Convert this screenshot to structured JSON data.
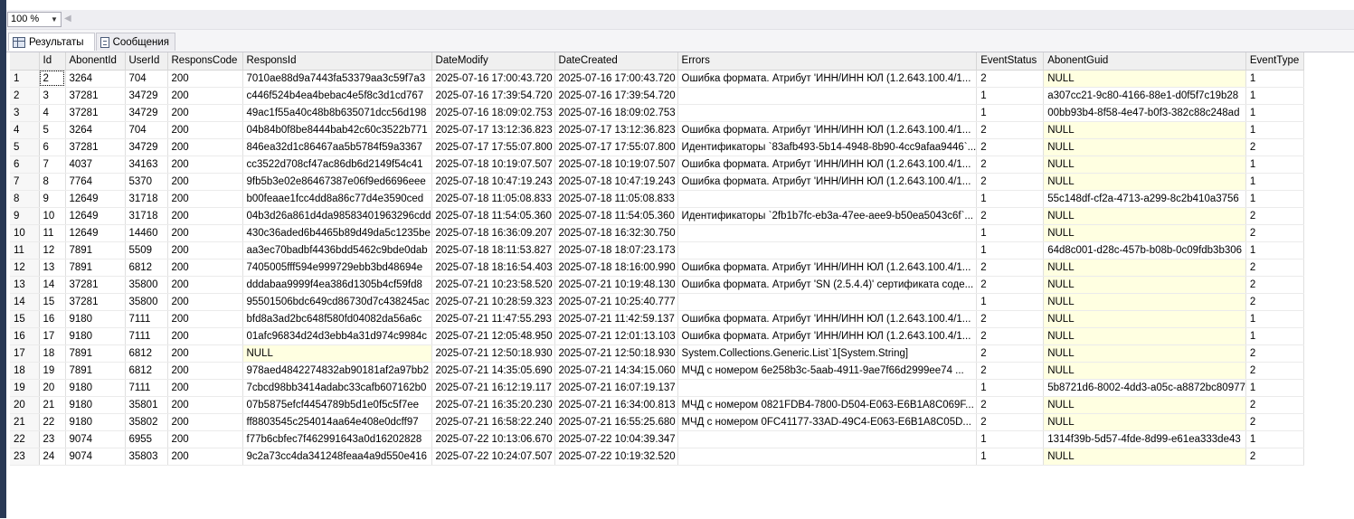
{
  "zoom": {
    "value": "100 %"
  },
  "tabs": [
    {
      "label": "Результаты",
      "icon": "grid-results-icon",
      "active": true
    },
    {
      "label": "Сообщения",
      "icon": "messages-icon",
      "active": false
    }
  ],
  "colors": {
    "left_bar": "#293955",
    "null_cell": "#ffffe1"
  },
  "grid": {
    "columns": [
      "",
      "Id",
      "AbonentId",
      "UserId",
      "ResponsCode",
      "ResponsId",
      "DateModify",
      "DateCreated",
      "Errors",
      "EventStatus",
      "AbonentGuid",
      "EventType"
    ],
    "rows": [
      [
        "1",
        "2",
        "3264",
        "704",
        "200",
        "7010ae88d9a7443fa53379aa3c59f7a3",
        "2025-07-16 17:00:43.720",
        "2025-07-16 17:00:43.720",
        "Ошибка формата. Атрибут 'ИНН/ИНН ЮЛ (1.2.643.100.4/1...",
        "2",
        "NULL",
        "1"
      ],
      [
        "2",
        "3",
        "37281",
        "34729",
        "200",
        "c446f524b4ea4bebac4e5f8c3d1cd767",
        "2025-07-16 17:39:54.720",
        "2025-07-16 17:39:54.720",
        "",
        "1",
        "a307cc21-9c80-4166-88e1-d0f5f7c19b28",
        "1"
      ],
      [
        "3",
        "4",
        "37281",
        "34729",
        "200",
        "49ac1f55a40c48b8b635071dcc56d198",
        "2025-07-16 18:09:02.753",
        "2025-07-16 18:09:02.753",
        "",
        "1",
        "00bb93b4-8f58-4e47-b0f3-382c88c248ad",
        "1"
      ],
      [
        "4",
        "5",
        "3264",
        "704",
        "200",
        "04b84b0f8be8444bab42c60c3522b771",
        "2025-07-17 13:12:36.823",
        "2025-07-17 13:12:36.823",
        "Ошибка формата. Атрибут 'ИНН/ИНН ЮЛ (1.2.643.100.4/1...",
        "2",
        "NULL",
        "1"
      ],
      [
        "5",
        "6",
        "37281",
        "34729",
        "200",
        "846ea32d1c86467aa5b5784f59a3367",
        "2025-07-17 17:55:07.800",
        "2025-07-17 17:55:07.800",
        "Идентификаторы `83afb493-5b14-4948-8b90-4cc9afaa9446`...",
        "2",
        "NULL",
        "2"
      ],
      [
        "6",
        "7",
        "4037",
        "34163",
        "200",
        "cc3522d708cf47ac86db6d2149f54c41",
        "2025-07-18 10:19:07.507",
        "2025-07-18 10:19:07.507",
        "Ошибка формата. Атрибут 'ИНН/ИНН ЮЛ (1.2.643.100.4/1...",
        "2",
        "NULL",
        "1"
      ],
      [
        "7",
        "8",
        "7764",
        "5370",
        "200",
        "9fb5b3e02e86467387e06f9ed6696eee",
        "2025-07-18 10:47:19.243",
        "2025-07-18 10:47:19.243",
        "Ошибка формата. Атрибут 'ИНН/ИНН ЮЛ (1.2.643.100.4/1...",
        "2",
        "NULL",
        "1"
      ],
      [
        "8",
        "9",
        "12649",
        "31718",
        "200",
        "b00feaae1fcc4dd8a86c77d4e3590ced",
        "2025-07-18 11:05:08.833",
        "2025-07-18 11:05:08.833",
        "",
        "1",
        "55c148df-cf2a-4713-a299-8c2b410a3756",
        "1"
      ],
      [
        "9",
        "10",
        "12649",
        "31718",
        "200",
        "04b3d26a861d4da98583401963296cdd",
        "2025-07-18 11:54:05.360",
        "2025-07-18 11:54:05.360",
        "Идентификаторы `2fb1b7fc-eb3a-47ee-aee9-b50ea5043c6f`...",
        "2",
        "NULL",
        "2"
      ],
      [
        "10",
        "11",
        "12649",
        "14460",
        "200",
        "430c36aded6b4465b89d49da5c1235be",
        "2025-07-18 16:36:09.207",
        "2025-07-18 16:32:30.750",
        "",
        "1",
        "NULL",
        "2"
      ],
      [
        "11",
        "12",
        "7891",
        "5509",
        "200",
        "aa3ec70badbf4436bdd5462c9bde0dab",
        "2025-07-18 18:11:53.827",
        "2025-07-18 18:07:23.173",
        "",
        "1",
        "64d8c001-d28c-457b-b08b-0c09fdb3b306",
        "1"
      ],
      [
        "12",
        "13",
        "7891",
        "6812",
        "200",
        "7405005fff594e999729ebb3bd48694e",
        "2025-07-18 18:16:54.403",
        "2025-07-18 18:16:00.990",
        "Ошибка формата. Атрибут 'ИНН/ИНН ЮЛ (1.2.643.100.4/1...",
        "2",
        "NULL",
        "2"
      ],
      [
        "13",
        "14",
        "37281",
        "35800",
        "200",
        "dddabaa9999f4ea386d1305b4cf59fd8",
        "2025-07-21 10:23:58.520",
        "2025-07-21 10:19:48.130",
        "Ошибка формата. Атрибут 'SN (2.5.4.4)' сертификата соде...",
        "2",
        "NULL",
        "2"
      ],
      [
        "14",
        "15",
        "37281",
        "35800",
        "200",
        "95501506bdc649cd86730d7c438245ac",
        "2025-07-21 10:28:59.323",
        "2025-07-21 10:25:40.777",
        "",
        "1",
        "NULL",
        "2"
      ],
      [
        "15",
        "16",
        "9180",
        "7111",
        "200",
        "bfd8a3ad2bc648f580fd04082da56a6c",
        "2025-07-21 11:47:55.293",
        "2025-07-21 11:42:59.137",
        "Ошибка формата. Атрибут 'ИНН/ИНН ЮЛ (1.2.643.100.4/1...",
        "2",
        "NULL",
        "1"
      ],
      [
        "16",
        "17",
        "9180",
        "7111",
        "200",
        "01afc96834d24d3ebb4a31d974c9984c",
        "2025-07-21 12:05:48.950",
        "2025-07-21 12:01:13.103",
        "Ошибка формата. Атрибут 'ИНН/ИНН ЮЛ (1.2.643.100.4/1...",
        "2",
        "NULL",
        "1"
      ],
      [
        "17",
        "18",
        "7891",
        "6812",
        "200",
        "NULL",
        "2025-07-21 12:50:18.930",
        "2025-07-21 12:50:18.930",
        "System.Collections.Generic.List`1[System.String]",
        "2",
        "NULL",
        "2"
      ],
      [
        "18",
        "19",
        "7891",
        "6812",
        "200",
        "978aed4842274832ab90181af2a97bb2",
        "2025-07-21 14:35:05.690",
        "2025-07-21 14:34:15.060",
        "МЧД с номером 6e258b3c-5aab-4911-9ae7f66d2999ee74 ...",
        "2",
        "NULL",
        "2"
      ],
      [
        "19",
        "20",
        "9180",
        "7111",
        "200",
        "7cbcd98bb3414adabc33cafb607162b0",
        "2025-07-21 16:12:19.117",
        "2025-07-21 16:07:19.137",
        "",
        "1",
        "5b8721d6-8002-4dd3-a05c-a8872bc80977",
        "1"
      ],
      [
        "20",
        "21",
        "9180",
        "35801",
        "200",
        "07b5875efcf4454789b5d1e0f5c5f7ee",
        "2025-07-21 16:35:20.230",
        "2025-07-21 16:34:00.813",
        "МЧД с номером 0821FDB4-7800-D504-E063-E6B1A8C069F...",
        "2",
        "NULL",
        "2"
      ],
      [
        "21",
        "22",
        "9180",
        "35802",
        "200",
        "ff8803545c254014aa64e408e0dcff97",
        "2025-07-21 16:58:22.240",
        "2025-07-21 16:55:25.680",
        "МЧД с номером 0FC41177-33AD-49C4-E063-E6B1A8C05D...",
        "2",
        "NULL",
        "2"
      ],
      [
        "22",
        "23",
        "9074",
        "6955",
        "200",
        "f77b6cbfec7f462991643a0d16202828",
        "2025-07-22 10:13:06.670",
        "2025-07-22 10:04:39.347",
        "",
        "1",
        "1314f39b-5d57-4fde-8d99-e61ea333de43",
        "1"
      ],
      [
        "23",
        "24",
        "9074",
        "35803",
        "200",
        "9c2a73cc4da341248feaa4a9d550e416",
        "2025-07-22 10:24:07.507",
        "2025-07-22 10:19:32.520",
        "",
        "1",
        "NULL",
        "2"
      ]
    ]
  }
}
